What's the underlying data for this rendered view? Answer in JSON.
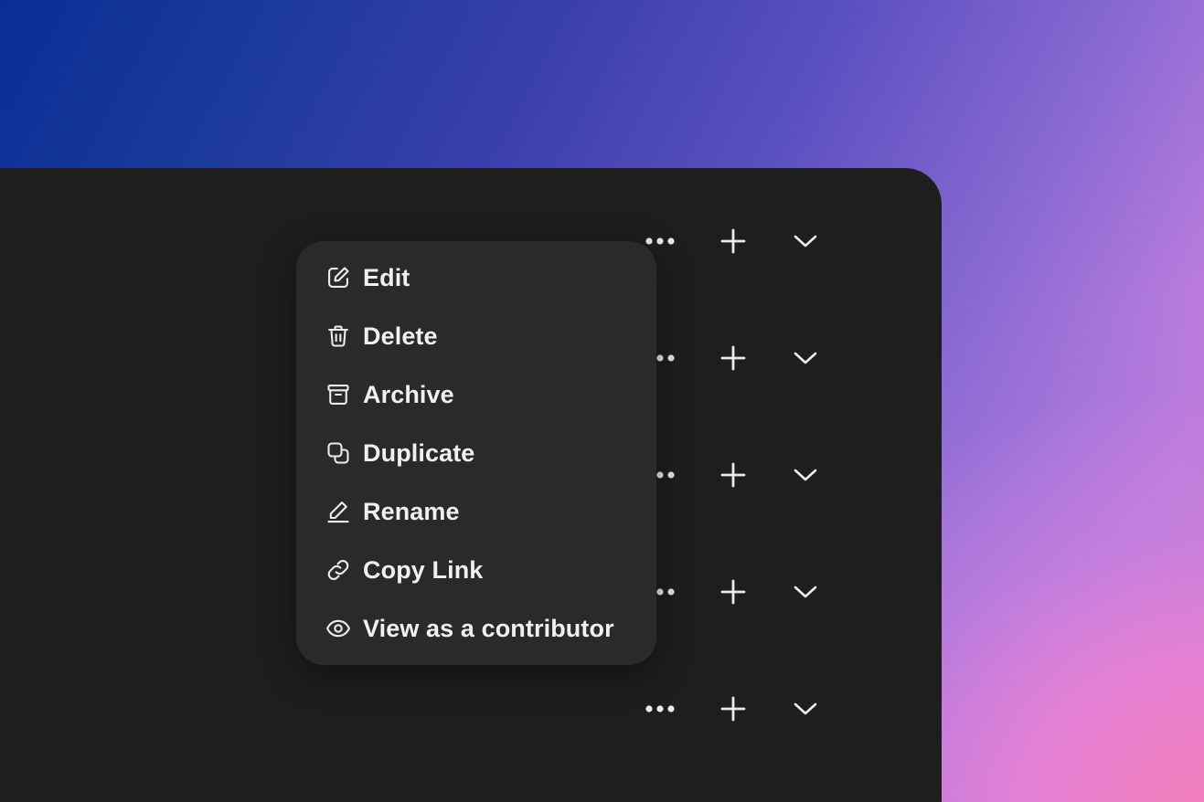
{
  "background": {
    "gradient_start": "#0a2d94",
    "gradient_mid": "#8a6ad2",
    "gradient_end": "#f27fbd"
  },
  "panel": {
    "color": "#1e1e1e"
  },
  "rows": [
    {
      "more_icon": "more-horizontal-icon",
      "add_icon": "plus-icon",
      "expand_icon": "chevron-down-icon"
    },
    {
      "more_icon": "more-horizontal-icon",
      "add_icon": "plus-icon",
      "expand_icon": "chevron-down-icon"
    },
    {
      "more_icon": "more-horizontal-icon",
      "add_icon": "plus-icon",
      "expand_icon": "chevron-down-icon"
    },
    {
      "more_icon": "more-horizontal-icon",
      "add_icon": "plus-icon",
      "expand_icon": "chevron-down-icon"
    },
    {
      "more_icon": "more-horizontal-icon",
      "add_icon": "plus-icon",
      "expand_icon": "chevron-down-icon"
    }
  ],
  "context_menu": {
    "background": "#2a2a2a",
    "text_color": "#f0f0f0",
    "items": [
      {
        "label": "Edit",
        "icon": "edit-icon"
      },
      {
        "label": "Delete",
        "icon": "trash-icon"
      },
      {
        "label": "Archive",
        "icon": "archive-icon"
      },
      {
        "label": "Duplicate",
        "icon": "duplicate-icon"
      },
      {
        "label": "Rename",
        "icon": "pencil-icon"
      },
      {
        "label": "Copy Link",
        "icon": "link-icon"
      },
      {
        "label": "View as a contributor",
        "icon": "eye-icon"
      }
    ]
  }
}
